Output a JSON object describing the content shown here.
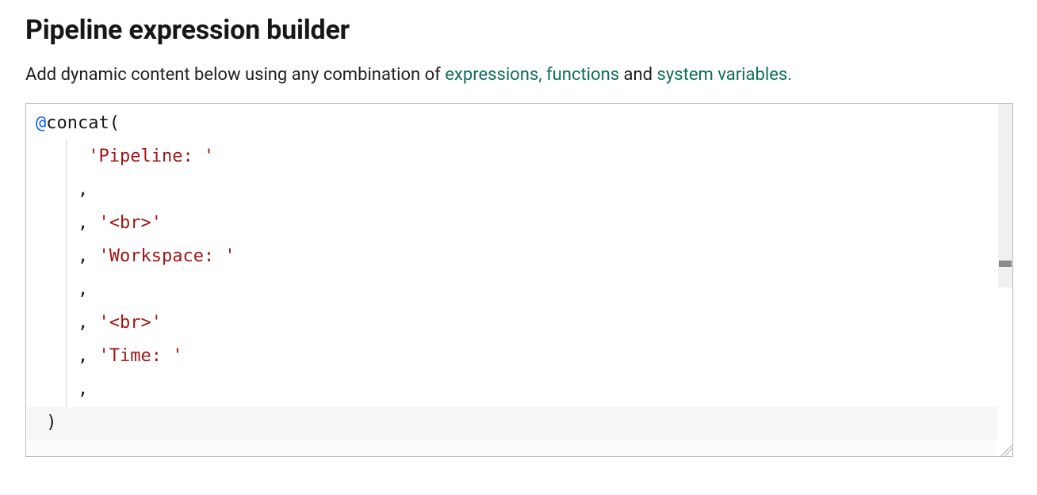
{
  "header": {
    "title": "Pipeline expression builder"
  },
  "subtitle": {
    "prefix": "Add dynamic content below using any combination of ",
    "link_expressions": "expressions,",
    "link_functions": "functions",
    "middle": " and ",
    "link_system_variables": "system variables.",
    "suffix": ""
  },
  "editor": {
    "lines": [
      {
        "segments": [
          {
            "text": "@",
            "cls": "tok-at"
          },
          {
            "text": "concat",
            "cls": "tok-fn"
          },
          {
            "text": "(",
            "cls": "tok-punct"
          }
        ]
      },
      {
        "segments": [
          {
            "text": "     ",
            "cls": ""
          },
          {
            "text": "'Pipeline: '",
            "cls": "tok-str"
          }
        ]
      },
      {
        "segments": [
          {
            "text": "    ",
            "cls": ""
          },
          {
            "text": ",",
            "cls": "tok-punct"
          }
        ]
      },
      {
        "segments": [
          {
            "text": "    ",
            "cls": ""
          },
          {
            "text": ",",
            "cls": "tok-punct"
          },
          {
            "text": " ",
            "cls": ""
          },
          {
            "text": "'<br>'",
            "cls": "tok-str"
          }
        ]
      },
      {
        "segments": [
          {
            "text": "    ",
            "cls": ""
          },
          {
            "text": ",",
            "cls": "tok-punct"
          },
          {
            "text": " ",
            "cls": ""
          },
          {
            "text": "'Workspace: '",
            "cls": "tok-str"
          }
        ]
      },
      {
        "segments": [
          {
            "text": "    ",
            "cls": ""
          },
          {
            "text": ",",
            "cls": "tok-punct"
          }
        ]
      },
      {
        "segments": [
          {
            "text": "    ",
            "cls": ""
          },
          {
            "text": ",",
            "cls": "tok-punct"
          },
          {
            "text": " ",
            "cls": ""
          },
          {
            "text": "'<br>'",
            "cls": "tok-str"
          }
        ]
      },
      {
        "segments": [
          {
            "text": "    ",
            "cls": ""
          },
          {
            "text": ",",
            "cls": "tok-punct"
          },
          {
            "text": " ",
            "cls": ""
          },
          {
            "text": "'Time: '",
            "cls": "tok-str"
          }
        ]
      },
      {
        "segments": [
          {
            "text": "    ",
            "cls": ""
          },
          {
            "text": ",",
            "cls": "tok-punct"
          }
        ]
      },
      {
        "segments": [
          {
            "text": " ",
            "cls": ""
          },
          {
            "text": ")",
            "cls": "tok-punct"
          }
        ]
      }
    ]
  }
}
